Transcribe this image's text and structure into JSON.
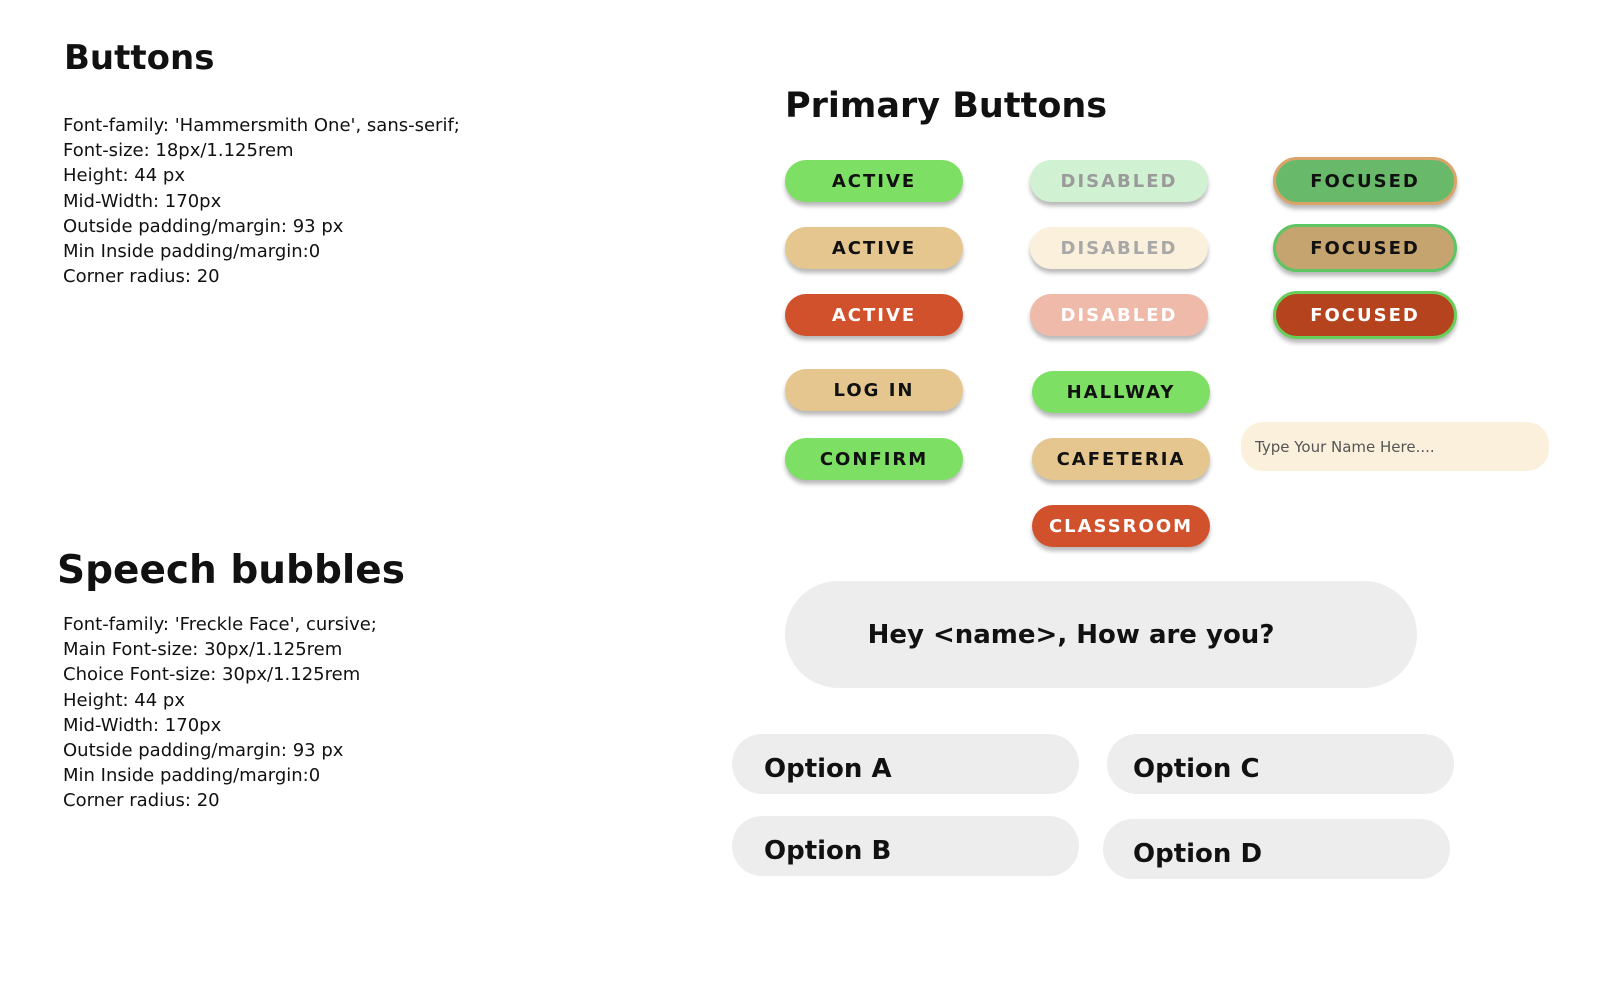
{
  "buttons_section": {
    "title": "Buttons",
    "specs": [
      "Font-family: 'Hammersmith One', sans-serif;",
      "Font-size: 18px/1.125rem",
      "Height: 44 px",
      "Mid-Width: 170px",
      "Outside padding/margin: 93 px",
      "Min Inside padding/margin:0",
      "Corner radius: 20"
    ]
  },
  "primary_section": {
    "title": "Primary Buttons",
    "colors": {
      "green": "#7ddf64",
      "tan": "#e5c68f",
      "red": "#d0512c",
      "green_disabled": "#d1f1d3",
      "tan_disabled": "#fbf0db",
      "red_disabled": "#efbaa9",
      "green_focused": "#69b96a",
      "tan_focused": "#c6a46f",
      "red_focused": "#b5441e"
    },
    "active_label": "ACTIVE",
    "disabled_label": "DISABLED",
    "focused_label": "FOCUSED",
    "nav": {
      "log_in": "LOG IN",
      "confirm": "CONFIRM",
      "hallway": "HALLWAY",
      "cafeteria": "CAFETERIA",
      "classroom": "CLASSROOM"
    },
    "name_input": {
      "placeholder": "Type Your Name Here...."
    }
  },
  "speech_section": {
    "title": "Speech bubbles",
    "specs": [
      "Font-family: 'Freckle Face', cursive;",
      "Main Font-size: 30px/1.125rem",
      "Choice Font-size: 30px/1.125rem",
      "Height: 44 px",
      "Mid-Width: 170px",
      "Outside padding/margin: 93 px",
      "Min Inside padding/margin:0",
      "Corner radius: 20"
    ],
    "main_bubble": "Hey <name>, How are you?",
    "options": {
      "a": "Option A",
      "b": "Option B",
      "c": "Option C",
      "d": "Option D"
    }
  }
}
